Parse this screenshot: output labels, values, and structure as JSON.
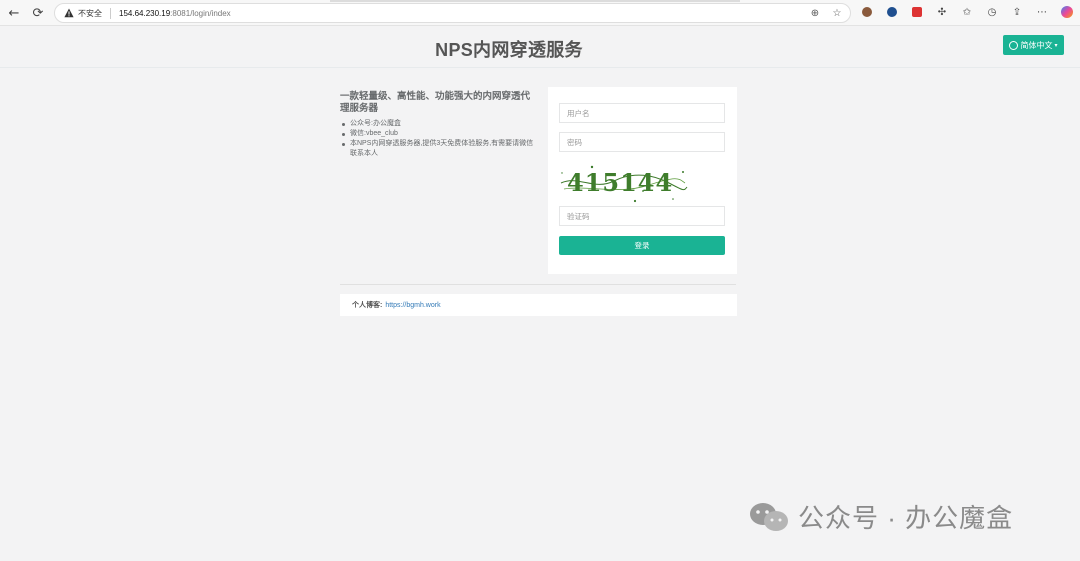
{
  "browser": {
    "security_label": "不安全",
    "url_host": "154.64.230.19",
    "url_rest": ":8081/login/index"
  },
  "header": {
    "title": "NPS内网穿透服务",
    "lang_button": "简体中文"
  },
  "info": {
    "title": "一款轻量级、高性能、功能强大的内网穿透代理服务器",
    "items": [
      "公众号:办公魔盒",
      "微信:vbee_club",
      "本NPS内网穿透服务器,提供3天免费体验服务,有需要请微信联系本人"
    ]
  },
  "login": {
    "username_placeholder": "用户名",
    "password_placeholder": "密码",
    "captcha_placeholder": "验证码",
    "captcha_text": "415144",
    "submit_label": "登录"
  },
  "footer": {
    "label": "个人博客:",
    "link": "https://bgmh.work"
  },
  "watermark": {
    "text": "公众号 · 办公魔盒"
  },
  "colors": {
    "accent": "#1ab394",
    "link": "#337ab7",
    "background": "#f3f3f4"
  }
}
